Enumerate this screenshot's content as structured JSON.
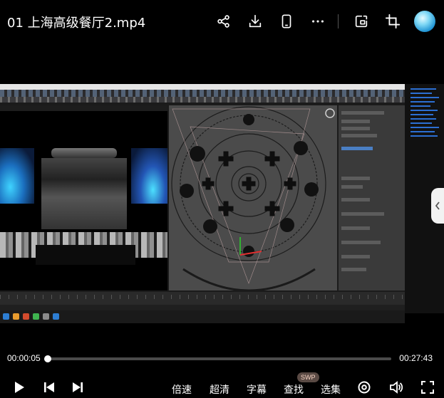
{
  "header": {
    "title": "01 上海高级餐厅2.mp4",
    "icons": [
      "share-icon",
      "download-icon",
      "phone-icon",
      "more-icon",
      "pip-icon",
      "crop-icon",
      "avatar"
    ]
  },
  "player": {
    "current_time": "00:00:05",
    "duration": "00:27:43",
    "progress": 0.003,
    "speed_label": "倍速",
    "quality_label": "超清",
    "subtitle_label": "字幕",
    "search_label": "查找",
    "search_badge": "SWP",
    "episodes_label": "选集"
  },
  "colors": {
    "background": "#000000",
    "accent": "#1a8fd1",
    "track": "#4a4a4a",
    "badge": "#5a4a44"
  }
}
